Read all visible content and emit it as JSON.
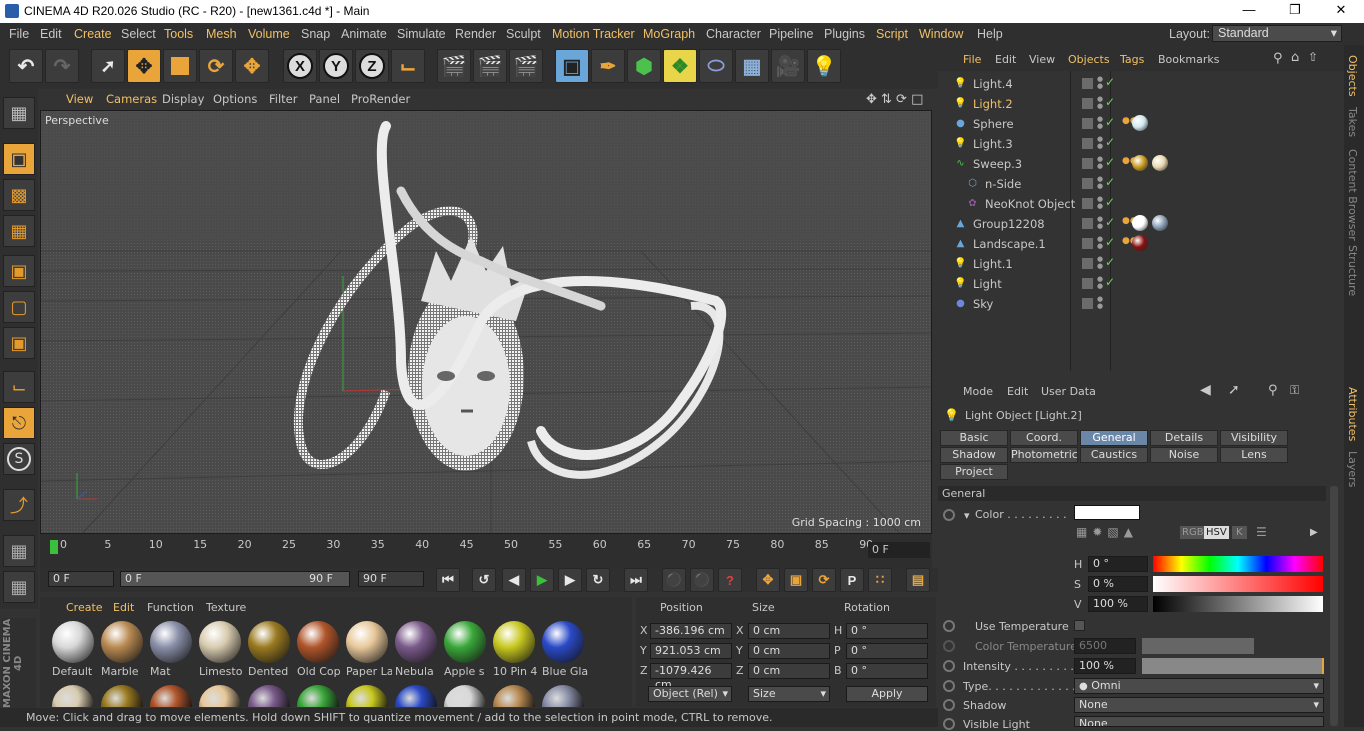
{
  "window": {
    "title": "CINEMA 4D R20.026 Studio (RC - R20) - [new1361.c4d *] - Main"
  },
  "menu": [
    "File",
    "Edit",
    "Create",
    "Select",
    "Tools",
    "Mesh",
    "Volume",
    "Snap",
    "Animate",
    "Simulate",
    "Render",
    "Sculpt",
    "Motion Tracker",
    "MoGraph",
    "Character",
    "Pipeline",
    "Plugins",
    "Script",
    "Window",
    "Help"
  ],
  "menu_highlighted": [
    "Create",
    "Tools",
    "Mesh",
    "Volume",
    "Motion Tracker",
    "MoGraph",
    "Script",
    "Window"
  ],
  "layout": {
    "label": "Layout:",
    "value": "Standard"
  },
  "toolbar": {
    "x": "X",
    "y": "Y",
    "z": "Z"
  },
  "viewport": {
    "menu": [
      "View",
      "Cameras",
      "Display",
      "Options",
      "Filter",
      "Panel",
      "ProRender"
    ],
    "camera": "Perspective",
    "grid_spacing": "Grid Spacing : 1000 cm"
  },
  "timeline": {
    "ticks": [
      "0",
      "5",
      "10",
      "15",
      "20",
      "25",
      "30",
      "35",
      "40",
      "45",
      "50",
      "55",
      "60",
      "65",
      "70",
      "75",
      "80",
      "85",
      "90"
    ],
    "current_frame": "0 F",
    "start": "0 F",
    "range_start": "0 F",
    "range_end": "90 F",
    "end": "90 F"
  },
  "materials": {
    "menu": [
      "Create",
      "Edit",
      "Function",
      "Texture"
    ],
    "items": [
      {
        "name": "Default",
        "color": "#d8d8d8"
      },
      {
        "name": "Marble",
        "color": "#b98a52"
      },
      {
        "name": "Mat",
        "color": "#8a8fa8"
      },
      {
        "name": "Limesto",
        "color": "#d8cbb0"
      },
      {
        "name": "Dented",
        "color": "#9a7a20"
      },
      {
        "name": "Old Cop",
        "color": "#b0552a"
      },
      {
        "name": "Paper La",
        "color": "#e8c89a"
      },
      {
        "name": "Nebula",
        "color": "#7a5a8a"
      },
      {
        "name": "Apple s",
        "color": "#3aa83a"
      },
      {
        "name": "10 Pin 4",
        "color": "#c8c820"
      },
      {
        "name": "Blue Gla",
        "color": "#2a4ac8"
      }
    ]
  },
  "coordinates": {
    "headers": [
      "Position",
      "Size",
      "Rotation"
    ],
    "rows": [
      {
        "axis": "X",
        "pos": "-386.196 cm",
        "size_axis": "X",
        "size": "0 cm",
        "rot_axis": "H",
        "rot": "0 °"
      },
      {
        "axis": "Y",
        "pos": "921.053 cm",
        "size_axis": "Y",
        "size": "0 cm",
        "rot_axis": "P",
        "rot": "0 °"
      },
      {
        "axis": "Z",
        "pos": "-1079.426 cm",
        "size_axis": "Z",
        "size": "0 cm",
        "rot_axis": "B",
        "rot": "0 °"
      }
    ],
    "mode": "Object (Rel)",
    "size_mode": "Size",
    "apply": "Apply"
  },
  "status": "Move: Click and drag to move elements. Hold down SHIFT to quantize movement / add to the selection in point mode, CTRL to remove.",
  "object_manager": {
    "menu": [
      "File",
      "Edit",
      "View",
      "Objects",
      "Tags",
      "Bookmarks"
    ],
    "objects": [
      {
        "name": "Light.4",
        "icon": "light",
        "indent": 0,
        "check": true,
        "selected": false
      },
      {
        "name": "Light.2",
        "icon": "light",
        "indent": 0,
        "check": true,
        "selected": true
      },
      {
        "name": "Sphere",
        "icon": "sphere",
        "indent": 0,
        "check": true,
        "selected": false
      },
      {
        "name": "Light.3",
        "icon": "light",
        "indent": 0,
        "check": true,
        "selected": false
      },
      {
        "name": "Sweep.3",
        "icon": "sweep",
        "indent": 0,
        "check": true,
        "selected": false
      },
      {
        "name": "n-Side",
        "icon": "nside",
        "indent": 1,
        "check": true,
        "selected": false
      },
      {
        "name": "NeoKnot Object",
        "icon": "knot",
        "indent": 1,
        "check": true,
        "selected": false
      },
      {
        "name": "Group12208",
        "icon": "group",
        "indent": 0,
        "check": true,
        "selected": false
      },
      {
        "name": "Landscape.1",
        "icon": "landscape",
        "indent": 0,
        "check": true,
        "selected": false
      },
      {
        "name": "Light.1",
        "icon": "light",
        "indent": 0,
        "check": true,
        "selected": false
      },
      {
        "name": "Light",
        "icon": "light",
        "indent": 0,
        "check": true,
        "selected": false
      },
      {
        "name": "Sky",
        "icon": "sky",
        "indent": 0,
        "check": false,
        "selected": false
      }
    ]
  },
  "side_tabs": [
    "Objects",
    "Takes",
    "Content Browser",
    "Structure",
    "Attributes",
    "Layers"
  ],
  "attributes": {
    "menu": [
      "Mode",
      "Edit",
      "User Data"
    ],
    "object_title": "Light Object [Light.2]",
    "tabs": [
      [
        "Basic",
        "Coord.",
        "General",
        "Details",
        "Visibility"
      ],
      [
        "Shadow",
        "Photometric",
        "Caustics",
        "Noise",
        "Lens"
      ],
      [
        "Project"
      ]
    ],
    "active_tab": "General",
    "section": "General",
    "color_label": "Color . . . . . . . . .",
    "h": {
      "label": "H",
      "value": "0 °"
    },
    "s": {
      "label": "S",
      "value": "0 %"
    },
    "v": {
      "label": "V",
      "value": "100 %"
    },
    "hsv_btn": "HSV",
    "rgb_btn": "RGB",
    "k_btn": "K",
    "use_temperature": "Use Temperature",
    "color_temperature": {
      "label": "Color Temperature",
      "value": "6500"
    },
    "intensity": {
      "label": "Intensity . . . . . . . . .",
      "value": "100 %",
      "level": 1.0
    },
    "type": {
      "label": "Type. . . . . . . . . . . . .",
      "value": "Omni"
    },
    "shadow": {
      "label": "Shadow",
      "value": "None"
    },
    "visible_light": {
      "label": "Visible Light",
      "value": "None"
    }
  }
}
